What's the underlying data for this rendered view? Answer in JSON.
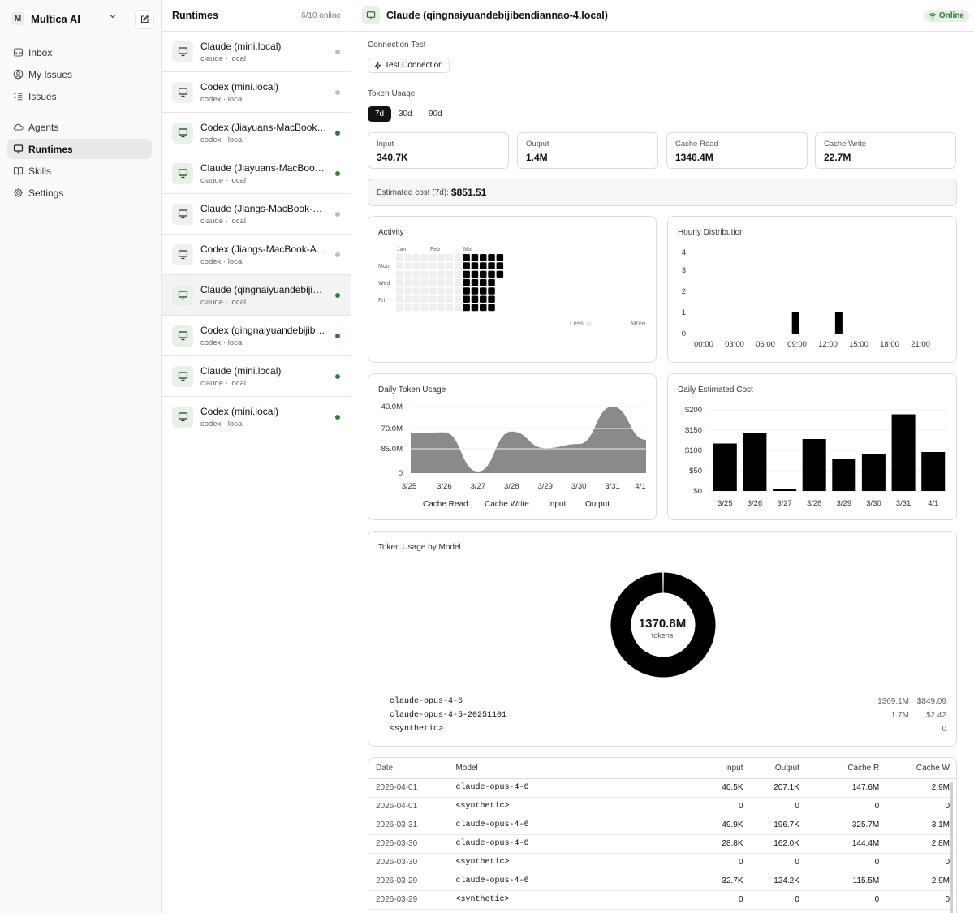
{
  "workspace": {
    "initial": "M",
    "name": "Multica AI"
  },
  "nav": [
    {
      "label": "Inbox",
      "icon": "inbox-icon"
    },
    {
      "label": "My Issues",
      "icon": "user-circle-icon"
    },
    {
      "label": "Issues",
      "icon": "list-checks-icon"
    },
    {
      "label": "Agents",
      "icon": "cloud-icon"
    },
    {
      "label": "Runtimes",
      "icon": "monitor-icon",
      "active": true
    },
    {
      "label": "Skills",
      "icon": "book-open-icon"
    },
    {
      "label": "Settings",
      "icon": "gear-icon"
    }
  ],
  "runtimes": {
    "title": "Runtimes",
    "count": "6/10 online",
    "items": [
      {
        "name": "Claude (mini.local)",
        "sub": "claude · local",
        "online": false
      },
      {
        "name": "Codex (mini.local)",
        "sub": "codex · local",
        "online": false
      },
      {
        "name": "Codex (Jiayuans-MacBook.local)",
        "sub": "codex · local",
        "online": true
      },
      {
        "name": "Claude (Jiayuans-MacBook.local)",
        "sub": "claude · local",
        "online": true
      },
      {
        "name": "Claude (Jiangs-MacBook-Air.local)",
        "sub": "claude · local",
        "online": false
      },
      {
        "name": "Codex (Jiangs-MacBook-Air.local)",
        "sub": "codex · local",
        "online": false
      },
      {
        "name": "Claude (qingnaiyuandebijibendiannao-4.local)",
        "sub": "claude · local",
        "online": true,
        "selected": true
      },
      {
        "name": "Codex (qingnaiyuandebijibendiannao-4.local)",
        "sub": "codex · local",
        "online": true
      },
      {
        "name": "Claude (mini.local)",
        "sub": "claude · local",
        "online": true
      },
      {
        "name": "Codex (mini.local)",
        "sub": "codex · local",
        "online": true
      }
    ]
  },
  "detail": {
    "title": "Claude (qingnaiyuandebijibendiannao-4.local)",
    "status": "Online",
    "connection_label": "Connection Test",
    "test_button": "Test Connection",
    "token_usage_label": "Token Usage",
    "periods": [
      "7d",
      "30d",
      "90d"
    ],
    "active_period": "7d",
    "stats": [
      {
        "label": "Input",
        "value": "340.7K"
      },
      {
        "label": "Output",
        "value": "1.4M"
      },
      {
        "label": "Cache Read",
        "value": "1346.4M"
      },
      {
        "label": "Cache Write",
        "value": "22.7M"
      }
    ],
    "cost_label": "Estimated cost (7d):",
    "cost_value": "$851.51"
  },
  "colors": {
    "online": "#2e7d32",
    "offline": "#bdbdbd",
    "bar": "#000000",
    "area": "#8a8a8a"
  },
  "activity": {
    "title": "Activity",
    "months": [
      "Jan",
      "Feb",
      "Mar"
    ],
    "days": [
      "Mon",
      "Wed",
      "Fri"
    ],
    "less": "Less",
    "more": "More"
  },
  "chart_data": [
    {
      "type": "bar",
      "title": "Hourly Distribution",
      "categories": [
        "00:00",
        "01:00",
        "02:00",
        "03:00",
        "04:00",
        "05:00",
        "06:00",
        "07:00",
        "08:00",
        "09:00",
        "10:00",
        "11:00",
        "12:00",
        "13:00",
        "14:00",
        "15:00",
        "16:00",
        "17:00",
        "18:00",
        "19:00",
        "20:00",
        "21:00",
        "22:00",
        "23:00"
      ],
      "values": [
        0,
        0,
        0,
        0,
        0,
        0,
        0,
        0,
        1,
        0,
        0,
        0,
        0,
        0,
        0,
        0,
        0,
        0,
        0,
        0,
        0,
        0,
        0,
        0
      ],
      "extra_values_note": "",
      "x_tick_labels": [
        "00:00",
        "03:00",
        "06:00",
        "09:00",
        "12:00",
        "15:00",
        "18:00",
        "21:00"
      ],
      "y_ticks": [
        0,
        1,
        2,
        3,
        4
      ],
      "ylim": [
        0,
        4
      ],
      "grid": false
    },
    {
      "type": "area",
      "title": "Daily Token Usage",
      "categories": [
        "3/25",
        "3/26",
        "3/27",
        "3/28",
        "3/29",
        "3/30",
        "3/31",
        "4/1"
      ],
      "y_tick_labels": [
        "40.0M",
        "70.0M",
        "85.0M",
        "0"
      ],
      "series": [
        {
          "name": "Cache Read",
          "values": [
            240,
            245,
            10,
            250,
            150,
            175,
            400,
            200
          ]
        }
      ],
      "legend": [
        "Cache Read",
        "Cache Write",
        "Input",
        "Output"
      ],
      "legend_position": "bottom",
      "ylim": [
        0,
        400
      ],
      "grid": true
    },
    {
      "type": "bar",
      "title": "Daily Estimated Cost",
      "categories": [
        "3/25",
        "3/26",
        "3/27",
        "3/28",
        "3/29",
        "3/30",
        "3/31",
        "4/1"
      ],
      "values": [
        117,
        142,
        5,
        128,
        79,
        92,
        189,
        96
      ],
      "y_tick_labels": [
        "$200",
        "$150",
        "$100",
        "$50",
        "$0"
      ],
      "ylim": [
        0,
        200
      ],
      "grid": true
    },
    {
      "type": "pie",
      "title": "Token Usage by Model",
      "center_value": "1370.8M",
      "center_label": "tokens",
      "slices": [
        {
          "name": "claude-opus-4-6",
          "value": 1369.1
        },
        {
          "name": "claude-opus-4-5-20251101",
          "value": 1.7
        },
        {
          "name": "<synthetic>",
          "value": 0
        }
      ]
    }
  ],
  "models": [
    {
      "name": "claude-opus-4-6",
      "tokens": "1369.1M",
      "cost": "$849.09"
    },
    {
      "name": "claude-opus-4-5-20251101",
      "tokens": "1.7M",
      "cost": "$2.42"
    },
    {
      "name": "<synthetic>",
      "tokens": "",
      "cost": "0"
    }
  ],
  "table": {
    "headers": [
      "Date",
      "Model",
      "Input",
      "Output",
      "Cache R",
      "Cache W"
    ],
    "rows": [
      [
        "2026-04-01",
        "claude-opus-4-6",
        "40.5K",
        "207.1K",
        "147.6M",
        "2.9M"
      ],
      [
        "2026-04-01",
        "<synthetic>",
        "0",
        "0",
        "0",
        "0"
      ],
      [
        "2026-03-31",
        "claude-opus-4-6",
        "49.9K",
        "196.7K",
        "325.7M",
        "3.1M"
      ],
      [
        "2026-03-30",
        "claude-opus-4-6",
        "28.8K",
        "162.0K",
        "144.4M",
        "2.8M"
      ],
      [
        "2026-03-30",
        "<synthetic>",
        "0",
        "0",
        "0",
        "0"
      ],
      [
        "2026-03-29",
        "claude-opus-4-6",
        "32.7K",
        "124.2K",
        "115.5M",
        "2.9M"
      ],
      [
        "2026-03-29",
        "<synthetic>",
        "0",
        "0",
        "0",
        "0"
      ]
    ]
  }
}
